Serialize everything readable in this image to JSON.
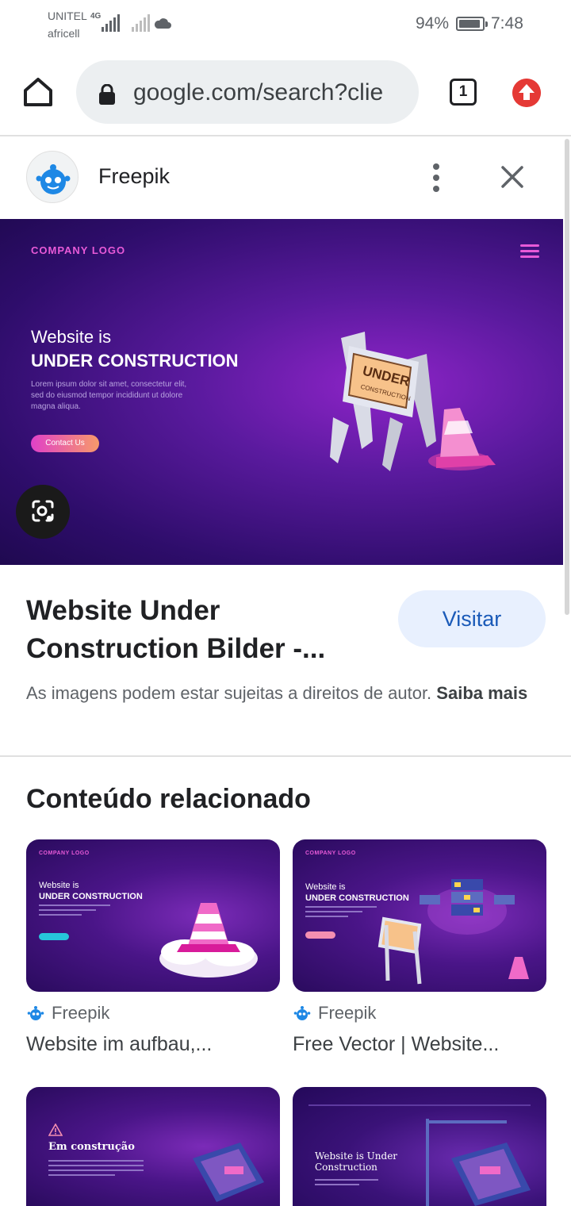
{
  "status_bar": {
    "carrier_primary": "UNITEL",
    "network_type": "4G",
    "carrier_secondary": "africell",
    "battery_percent_text": "94%",
    "battery_level": 0.94,
    "time": "7:48"
  },
  "toolbar": {
    "url": "google.com/search?clie",
    "tab_count": "1"
  },
  "source": {
    "name": "Freepik"
  },
  "hero": {
    "company_logo": "COMPANY LOGO",
    "title_line1": "Website is",
    "title_line2": "UNDER CONSTRUCTION",
    "body": "Lorem ipsum dolor sit amet, consectetur elit, sed do eiusmod tempor incididunt ut dolore magna aliqua.",
    "cta": "Contact Us",
    "sign_text1": "UNDER",
    "sign_text2": "CONSTRUCTION"
  },
  "result": {
    "title": "Website Under Construction Bilder -...",
    "visit_label": "Visitar",
    "rights_text": "As imagens podem estar sujeitas a direitos de autor.",
    "learn_more": "Saiba mais"
  },
  "related": {
    "heading": "Conteúdo relacionado",
    "items": [
      {
        "source": "Freepik",
        "title": "Website im aufbau,...",
        "thumb_logo": "COMPANY LOGO",
        "thumb_line1": "Website is",
        "thumb_line2": "UNDER CONSTRUCTION"
      },
      {
        "source": "Freepik",
        "title": "Free Vector | Website...",
        "thumb_logo": "COMPANY LOGO",
        "thumb_line1": "Website is",
        "thumb_line2": "UNDER CONSTRUCTION"
      },
      {
        "thumb_line1": "Em construção"
      },
      {
        "thumb_line1": "Website is Under",
        "thumb_line2": "Construction"
      }
    ]
  }
}
